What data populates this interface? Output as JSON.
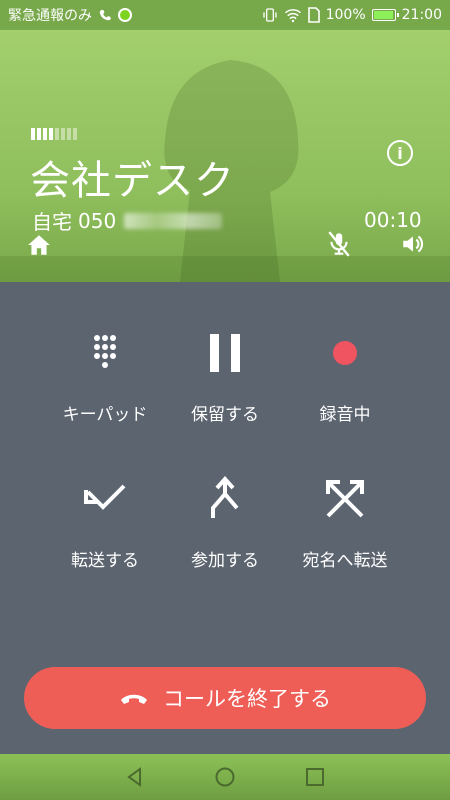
{
  "status_bar": {
    "carrier_text": "緊急通報のみ",
    "battery": "100%",
    "battery_level": 1.0,
    "time": "21:00"
  },
  "call": {
    "contact_name": "会社デスク",
    "line_label": "自宅",
    "number_visible": "050",
    "duration": "00:10",
    "signal_bars_total": 8,
    "signal_bars_on": 4
  },
  "header_icons": {
    "home": "home-icon",
    "info": "info-icon",
    "mic": "mic-off-icon",
    "speaker": "speaker-icon"
  },
  "controls": [
    {
      "key": "keypad",
      "label": "キーパッド",
      "icon": "dialpad-icon"
    },
    {
      "key": "hold",
      "label": "保留する",
      "icon": "pause-icon"
    },
    {
      "key": "record",
      "label": "録音中",
      "icon": "record-icon"
    },
    {
      "key": "transfer",
      "label": "転送する",
      "icon": "transfer-icon"
    },
    {
      "key": "join",
      "label": "参加する",
      "icon": "merge-icon"
    },
    {
      "key": "forward",
      "label": "宛名へ転送",
      "icon": "swap-arrows-icon"
    }
  ],
  "end_call": {
    "label": "コールを終了する",
    "icon": "hang-up-icon"
  },
  "colors": {
    "header_green": "#8fbe5c",
    "status_green": "#77a84a",
    "panel_gray": "#5c6470",
    "end_call_red": "#ee5e57",
    "record_red": "#f05460"
  }
}
